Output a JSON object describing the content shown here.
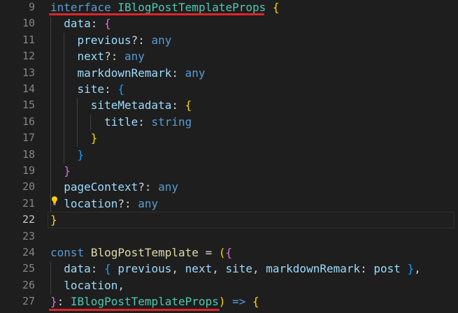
{
  "editor": {
    "colors": {
      "background": "#1e1e1e",
      "keyword": "#569cd6",
      "type": "#4ec9b0",
      "property": "#9cdcfe",
      "squiggle": "#e0242b"
    },
    "current_line": 22,
    "lines": [
      {
        "num": "9",
        "tokens": [
          [
            "k",
            "interface"
          ],
          [
            "pun",
            " "
          ],
          [
            "t",
            "IBlogPostTemplateProps"
          ],
          [
            "pun",
            " "
          ],
          [
            "br1",
            "{"
          ]
        ]
      },
      {
        "num": "10",
        "tokens": [
          [
            "pun",
            "  "
          ],
          [
            "p",
            "data"
          ],
          [
            "pun",
            ": "
          ],
          [
            "br2",
            "{"
          ]
        ]
      },
      {
        "num": "11",
        "tokens": [
          [
            "pun",
            "    "
          ],
          [
            "p",
            "previous"
          ],
          [
            "pun",
            "?: "
          ],
          [
            "k",
            "any"
          ]
        ]
      },
      {
        "num": "12",
        "tokens": [
          [
            "pun",
            "    "
          ],
          [
            "p",
            "next"
          ],
          [
            "pun",
            "?: "
          ],
          [
            "k",
            "any"
          ]
        ]
      },
      {
        "num": "13",
        "tokens": [
          [
            "pun",
            "    "
          ],
          [
            "p",
            "markdownRemark"
          ],
          [
            "pun",
            ": "
          ],
          [
            "k",
            "any"
          ]
        ]
      },
      {
        "num": "14",
        "tokens": [
          [
            "pun",
            "    "
          ],
          [
            "p",
            "site"
          ],
          [
            "pun",
            ": "
          ],
          [
            "br3",
            "{"
          ]
        ]
      },
      {
        "num": "15",
        "tokens": [
          [
            "pun",
            "      "
          ],
          [
            "p",
            "siteMetadata"
          ],
          [
            "pun",
            ": "
          ],
          [
            "br1",
            "{"
          ]
        ]
      },
      {
        "num": "16",
        "tokens": [
          [
            "pun",
            "        "
          ],
          [
            "p",
            "title"
          ],
          [
            "pun",
            ": "
          ],
          [
            "k",
            "string"
          ]
        ]
      },
      {
        "num": "17",
        "tokens": [
          [
            "pun",
            "      "
          ],
          [
            "br1",
            "}"
          ]
        ]
      },
      {
        "num": "18",
        "tokens": [
          [
            "pun",
            "    "
          ],
          [
            "br3",
            "}"
          ]
        ]
      },
      {
        "num": "19",
        "tokens": [
          [
            "pun",
            "  "
          ],
          [
            "br2",
            "}"
          ]
        ]
      },
      {
        "num": "20",
        "tokens": [
          [
            "pun",
            "  "
          ],
          [
            "p",
            "pageContext"
          ],
          [
            "pun",
            "?: "
          ],
          [
            "k",
            "any"
          ]
        ]
      },
      {
        "num": "21",
        "tokens": [
          [
            "pun",
            "  "
          ],
          [
            "p",
            "location"
          ],
          [
            "pun",
            "?: "
          ],
          [
            "k",
            "any"
          ]
        ]
      },
      {
        "num": "22",
        "tokens": [
          [
            "br1",
            "}"
          ]
        ]
      },
      {
        "num": "23",
        "tokens": []
      },
      {
        "num": "24",
        "tokens": [
          [
            "k",
            "const"
          ],
          [
            "pun",
            " "
          ],
          [
            "fn",
            "BlogPostTemplate"
          ],
          [
            "pun",
            " = "
          ],
          [
            "br1",
            "("
          ],
          [
            "br2",
            "{"
          ]
        ]
      },
      {
        "num": "25",
        "tokens": [
          [
            "pun",
            "  "
          ],
          [
            "p",
            "data"
          ],
          [
            "pun",
            ": "
          ],
          [
            "br3",
            "{"
          ],
          [
            "pun",
            " "
          ],
          [
            "p",
            "previous"
          ],
          [
            "pun",
            ", "
          ],
          [
            "p",
            "next"
          ],
          [
            "pun",
            ", "
          ],
          [
            "p",
            "site"
          ],
          [
            "pun",
            ", "
          ],
          [
            "p",
            "markdownRemark"
          ],
          [
            "pun",
            ": "
          ],
          [
            "p",
            "post"
          ],
          [
            "pun",
            " "
          ],
          [
            "br3",
            "}"
          ],
          [
            "pun",
            ","
          ]
        ]
      },
      {
        "num": "26",
        "tokens": [
          [
            "pun",
            "  "
          ],
          [
            "p",
            "location"
          ],
          [
            "pun",
            ","
          ]
        ]
      },
      {
        "num": "27",
        "tokens": [
          [
            "br2",
            "}"
          ],
          [
            "pun",
            ": "
          ],
          [
            "t",
            "IBlogPostTemplateProps"
          ],
          [
            "br1",
            ")"
          ],
          [
            "pun",
            " "
          ],
          [
            "k",
            "=>"
          ],
          [
            "pun",
            " "
          ],
          [
            "br1",
            "{"
          ]
        ]
      }
    ]
  }
}
